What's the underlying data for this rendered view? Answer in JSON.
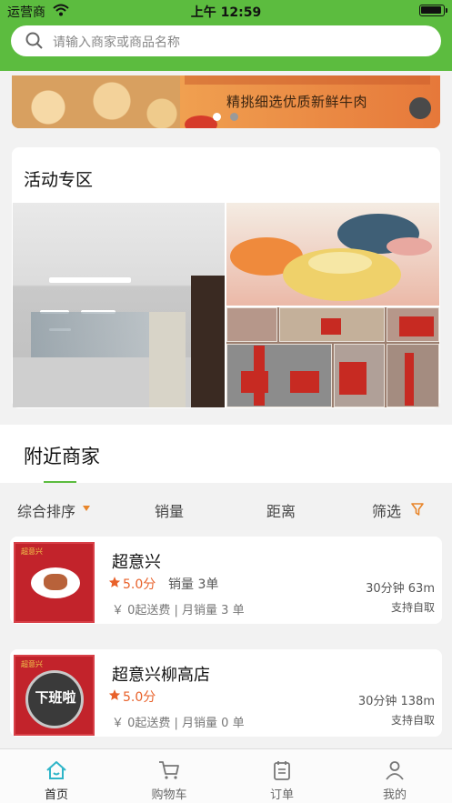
{
  "status_bar": {
    "carrier": "运营商",
    "time": "上午 12:59"
  },
  "search": {
    "placeholder": "请输入商家或商品名称"
  },
  "banner": {
    "tagline": "精挑细选优质新鲜牛肉",
    "active_index": 0,
    "dot_count": 2
  },
  "activity": {
    "title": "活动专区"
  },
  "nearby": {
    "title": "附近商家"
  },
  "filters": [
    {
      "label": "综合排序"
    },
    {
      "label": "销量"
    },
    {
      "label": "距离"
    },
    {
      "label": "筛选"
    }
  ],
  "shops": [
    {
      "name": "超意兴",
      "rating": "5.0分",
      "sales": "销量 3单",
      "fee": "￥ 0起送费 | 月销量 3 单",
      "distance": "30分钟 63m",
      "pickup": "支持自取",
      "logo_text": "超意兴",
      "status_text": ""
    },
    {
      "name": "超意兴柳高店",
      "rating": "5.0分",
      "sales": "",
      "fee": "￥ 0起送费 | 月销量 0 单",
      "distance": "30分钟 138m",
      "pickup": "支持自取",
      "logo_text": "超意兴",
      "status_text": "下班啦"
    }
  ],
  "tabbar": [
    {
      "label": "首页",
      "active": true
    },
    {
      "label": "购物车",
      "active": false
    },
    {
      "label": "订单",
      "active": false
    },
    {
      "label": "我的",
      "active": false
    }
  ],
  "colors": {
    "primary": "#5cbc3f",
    "accent": "#e8612a",
    "rating": "#e8612a"
  }
}
